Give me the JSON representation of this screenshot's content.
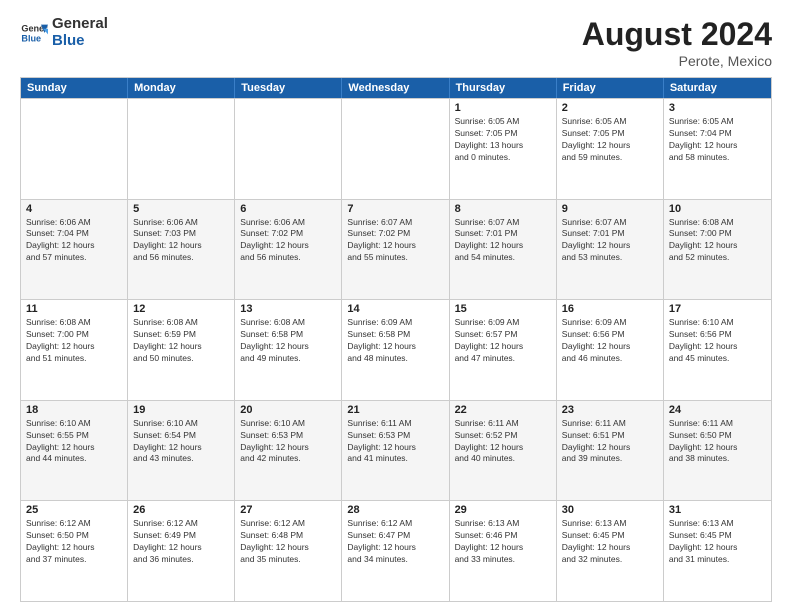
{
  "header": {
    "logo_line1": "General",
    "logo_line2": "Blue",
    "main_title": "August 2024",
    "subtitle": "Perote, Mexico"
  },
  "days_of_week": [
    "Sunday",
    "Monday",
    "Tuesday",
    "Wednesday",
    "Thursday",
    "Friday",
    "Saturday"
  ],
  "weeks": [
    [
      {
        "day": "",
        "info": ""
      },
      {
        "day": "",
        "info": ""
      },
      {
        "day": "",
        "info": ""
      },
      {
        "day": "",
        "info": ""
      },
      {
        "day": "1",
        "info": "Sunrise: 6:05 AM\nSunset: 7:05 PM\nDaylight: 13 hours\nand 0 minutes."
      },
      {
        "day": "2",
        "info": "Sunrise: 6:05 AM\nSunset: 7:05 PM\nDaylight: 12 hours\nand 59 minutes."
      },
      {
        "day": "3",
        "info": "Sunrise: 6:05 AM\nSunset: 7:04 PM\nDaylight: 12 hours\nand 58 minutes."
      }
    ],
    [
      {
        "day": "4",
        "info": "Sunrise: 6:06 AM\nSunset: 7:04 PM\nDaylight: 12 hours\nand 57 minutes."
      },
      {
        "day": "5",
        "info": "Sunrise: 6:06 AM\nSunset: 7:03 PM\nDaylight: 12 hours\nand 56 minutes."
      },
      {
        "day": "6",
        "info": "Sunrise: 6:06 AM\nSunset: 7:02 PM\nDaylight: 12 hours\nand 56 minutes."
      },
      {
        "day": "7",
        "info": "Sunrise: 6:07 AM\nSunset: 7:02 PM\nDaylight: 12 hours\nand 55 minutes."
      },
      {
        "day": "8",
        "info": "Sunrise: 6:07 AM\nSunset: 7:01 PM\nDaylight: 12 hours\nand 54 minutes."
      },
      {
        "day": "9",
        "info": "Sunrise: 6:07 AM\nSunset: 7:01 PM\nDaylight: 12 hours\nand 53 minutes."
      },
      {
        "day": "10",
        "info": "Sunrise: 6:08 AM\nSunset: 7:00 PM\nDaylight: 12 hours\nand 52 minutes."
      }
    ],
    [
      {
        "day": "11",
        "info": "Sunrise: 6:08 AM\nSunset: 7:00 PM\nDaylight: 12 hours\nand 51 minutes."
      },
      {
        "day": "12",
        "info": "Sunrise: 6:08 AM\nSunset: 6:59 PM\nDaylight: 12 hours\nand 50 minutes."
      },
      {
        "day": "13",
        "info": "Sunrise: 6:08 AM\nSunset: 6:58 PM\nDaylight: 12 hours\nand 49 minutes."
      },
      {
        "day": "14",
        "info": "Sunrise: 6:09 AM\nSunset: 6:58 PM\nDaylight: 12 hours\nand 48 minutes."
      },
      {
        "day": "15",
        "info": "Sunrise: 6:09 AM\nSunset: 6:57 PM\nDaylight: 12 hours\nand 47 minutes."
      },
      {
        "day": "16",
        "info": "Sunrise: 6:09 AM\nSunset: 6:56 PM\nDaylight: 12 hours\nand 46 minutes."
      },
      {
        "day": "17",
        "info": "Sunrise: 6:10 AM\nSunset: 6:56 PM\nDaylight: 12 hours\nand 45 minutes."
      }
    ],
    [
      {
        "day": "18",
        "info": "Sunrise: 6:10 AM\nSunset: 6:55 PM\nDaylight: 12 hours\nand 44 minutes."
      },
      {
        "day": "19",
        "info": "Sunrise: 6:10 AM\nSunset: 6:54 PM\nDaylight: 12 hours\nand 43 minutes."
      },
      {
        "day": "20",
        "info": "Sunrise: 6:10 AM\nSunset: 6:53 PM\nDaylight: 12 hours\nand 42 minutes."
      },
      {
        "day": "21",
        "info": "Sunrise: 6:11 AM\nSunset: 6:53 PM\nDaylight: 12 hours\nand 41 minutes."
      },
      {
        "day": "22",
        "info": "Sunrise: 6:11 AM\nSunset: 6:52 PM\nDaylight: 12 hours\nand 40 minutes."
      },
      {
        "day": "23",
        "info": "Sunrise: 6:11 AM\nSunset: 6:51 PM\nDaylight: 12 hours\nand 39 minutes."
      },
      {
        "day": "24",
        "info": "Sunrise: 6:11 AM\nSunset: 6:50 PM\nDaylight: 12 hours\nand 38 minutes."
      }
    ],
    [
      {
        "day": "25",
        "info": "Sunrise: 6:12 AM\nSunset: 6:50 PM\nDaylight: 12 hours\nand 37 minutes."
      },
      {
        "day": "26",
        "info": "Sunrise: 6:12 AM\nSunset: 6:49 PM\nDaylight: 12 hours\nand 36 minutes."
      },
      {
        "day": "27",
        "info": "Sunrise: 6:12 AM\nSunset: 6:48 PM\nDaylight: 12 hours\nand 35 minutes."
      },
      {
        "day": "28",
        "info": "Sunrise: 6:12 AM\nSunset: 6:47 PM\nDaylight: 12 hours\nand 34 minutes."
      },
      {
        "day": "29",
        "info": "Sunrise: 6:13 AM\nSunset: 6:46 PM\nDaylight: 12 hours\nand 33 minutes."
      },
      {
        "day": "30",
        "info": "Sunrise: 6:13 AM\nSunset: 6:45 PM\nDaylight: 12 hours\nand 32 minutes."
      },
      {
        "day": "31",
        "info": "Sunrise: 6:13 AM\nSunset: 6:45 PM\nDaylight: 12 hours\nand 31 minutes."
      }
    ]
  ]
}
